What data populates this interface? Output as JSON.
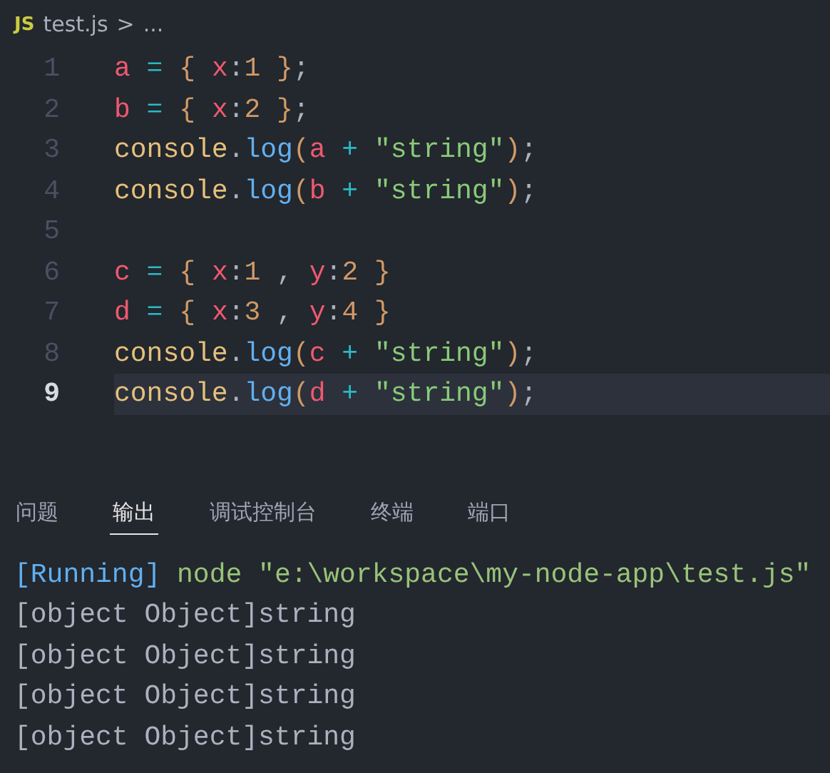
{
  "breadcrumb": {
    "file_badge": "JS",
    "file": "test.js",
    "separator": ">",
    "more": "..."
  },
  "editor": {
    "lines": [
      {
        "number": "1",
        "current": false,
        "tokens": [
          {
            "kind": "var",
            "text": "a"
          },
          {
            "kind": "op",
            "text": " = "
          },
          {
            "kind": "brace",
            "text": "{ "
          },
          {
            "kind": "var",
            "text": "x"
          },
          {
            "kind": "punct",
            "text": ":"
          },
          {
            "kind": "num",
            "text": "1"
          },
          {
            "kind": "brace",
            "text": " }"
          },
          {
            "kind": "punct",
            "text": ";"
          }
        ]
      },
      {
        "number": "2",
        "current": false,
        "tokens": [
          {
            "kind": "var",
            "text": "b"
          },
          {
            "kind": "op",
            "text": " = "
          },
          {
            "kind": "brace",
            "text": "{ "
          },
          {
            "kind": "var",
            "text": "x"
          },
          {
            "kind": "punct",
            "text": ":"
          },
          {
            "kind": "num",
            "text": "2"
          },
          {
            "kind": "brace",
            "text": " }"
          },
          {
            "kind": "punct",
            "text": ";"
          }
        ]
      },
      {
        "number": "3",
        "current": false,
        "tokens": [
          {
            "kind": "obj",
            "text": "console"
          },
          {
            "kind": "punct",
            "text": "."
          },
          {
            "kind": "fn",
            "text": "log"
          },
          {
            "kind": "brace",
            "text": "("
          },
          {
            "kind": "var",
            "text": "a"
          },
          {
            "kind": "op",
            "text": " + "
          },
          {
            "kind": "str",
            "text": "\"string\""
          },
          {
            "kind": "brace",
            "text": ")"
          },
          {
            "kind": "punct",
            "text": ";"
          }
        ]
      },
      {
        "number": "4",
        "current": false,
        "tokens": [
          {
            "kind": "obj",
            "text": "console"
          },
          {
            "kind": "punct",
            "text": "."
          },
          {
            "kind": "fn",
            "text": "log"
          },
          {
            "kind": "brace",
            "text": "("
          },
          {
            "kind": "var",
            "text": "b"
          },
          {
            "kind": "op",
            "text": " + "
          },
          {
            "kind": "str",
            "text": "\"string\""
          },
          {
            "kind": "brace",
            "text": ")"
          },
          {
            "kind": "punct",
            "text": ";"
          }
        ]
      },
      {
        "number": "5",
        "current": false
      },
      {
        "number": "6",
        "current": false,
        "tokens": [
          {
            "kind": "var",
            "text": "c"
          },
          {
            "kind": "op",
            "text": " = "
          },
          {
            "kind": "brace",
            "text": "{ "
          },
          {
            "kind": "var",
            "text": "x"
          },
          {
            "kind": "punct",
            "text": ":"
          },
          {
            "kind": "num",
            "text": "1"
          },
          {
            "kind": "punct",
            "text": " , "
          },
          {
            "kind": "var",
            "text": "y"
          },
          {
            "kind": "punct",
            "text": ":"
          },
          {
            "kind": "num",
            "text": "2"
          },
          {
            "kind": "brace",
            "text": " }"
          }
        ]
      },
      {
        "number": "7",
        "current": false,
        "tokens": [
          {
            "kind": "var",
            "text": "d"
          },
          {
            "kind": "op",
            "text": " = "
          },
          {
            "kind": "brace",
            "text": "{ "
          },
          {
            "kind": "var",
            "text": "x"
          },
          {
            "kind": "punct",
            "text": ":"
          },
          {
            "kind": "num",
            "text": "3"
          },
          {
            "kind": "punct",
            "text": " , "
          },
          {
            "kind": "var",
            "text": "y"
          },
          {
            "kind": "punct",
            "text": ":"
          },
          {
            "kind": "num",
            "text": "4"
          },
          {
            "kind": "brace",
            "text": " }"
          }
        ]
      },
      {
        "number": "8",
        "current": false,
        "tokens": [
          {
            "kind": "obj",
            "text": "console"
          },
          {
            "kind": "punct",
            "text": "."
          },
          {
            "kind": "fn",
            "text": "log"
          },
          {
            "kind": "brace",
            "text": "("
          },
          {
            "kind": "var",
            "text": "c"
          },
          {
            "kind": "op",
            "text": " + "
          },
          {
            "kind": "str",
            "text": "\"string\""
          },
          {
            "kind": "brace",
            "text": ")"
          },
          {
            "kind": "punct",
            "text": ";"
          }
        ]
      },
      {
        "number": "9",
        "current": true,
        "tokens": [
          {
            "kind": "obj",
            "text": "console"
          },
          {
            "kind": "punct",
            "text": "."
          },
          {
            "kind": "fn",
            "text": "log"
          },
          {
            "kind": "brace",
            "text": "("
          },
          {
            "kind": "var",
            "text": "d"
          },
          {
            "kind": "op",
            "text": " + "
          },
          {
            "kind": "str",
            "text": "\"string\""
          },
          {
            "kind": "brace",
            "text": ")"
          },
          {
            "kind": "punct",
            "text": ";"
          }
        ]
      }
    ]
  },
  "panel": {
    "tabs": [
      {
        "label": "问题",
        "selected": false
      },
      {
        "label": "输出",
        "selected": true
      },
      {
        "label": "调试控制台",
        "selected": false
      },
      {
        "label": "终端",
        "selected": false
      },
      {
        "label": "端口",
        "selected": false
      }
    ],
    "output": {
      "running_tag": "[Running]",
      "command": "node \"e:\\workspace\\my-node-app\\test.js\"",
      "lines": [
        "[object Object]string",
        "[object Object]string",
        "[object Object]string",
        "[object Object]string"
      ]
    }
  }
}
